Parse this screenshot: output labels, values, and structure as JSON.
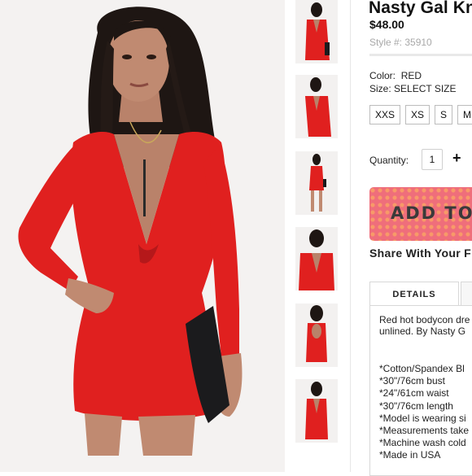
{
  "product": {
    "title": "Nasty Gal Kn",
    "price": "$48.00",
    "style_number": "Style #: 35910",
    "color_label": "Color:",
    "color_value": "RED",
    "size_label": "Size:",
    "size_value": "SELECT SIZE",
    "sizes": [
      "XXS",
      "XS",
      "S",
      "M"
    ],
    "quantity_label": "Quantity:",
    "quantity_value": "1",
    "quantity_increment": "+",
    "add_button": "ADD TO",
    "share_label": "Share With Your F"
  },
  "tabs": {
    "active": "DETAILS"
  },
  "details": {
    "description_lines": [
      "Red hot bodycon dre",
      "unlined. By Nasty G"
    ],
    "specs": [
      "*Cotton/Spandex Bl",
      "*30\"/76cm bust",
      "*24\"/61cm waist",
      "*30\"/76cm length",
      "*Model is wearing si",
      "*Measurements take",
      "*Machine wash cold",
      "*Made in USA"
    ]
  },
  "colors": {
    "dress": "#e0201f",
    "skin": "#b9826a",
    "hair": "#1e1613",
    "clutch": "#1b1b1d",
    "photo_bg": "#f4f2f1",
    "button": "#ef6e7b"
  },
  "icons": {
    "increment": "plus-icon"
  }
}
